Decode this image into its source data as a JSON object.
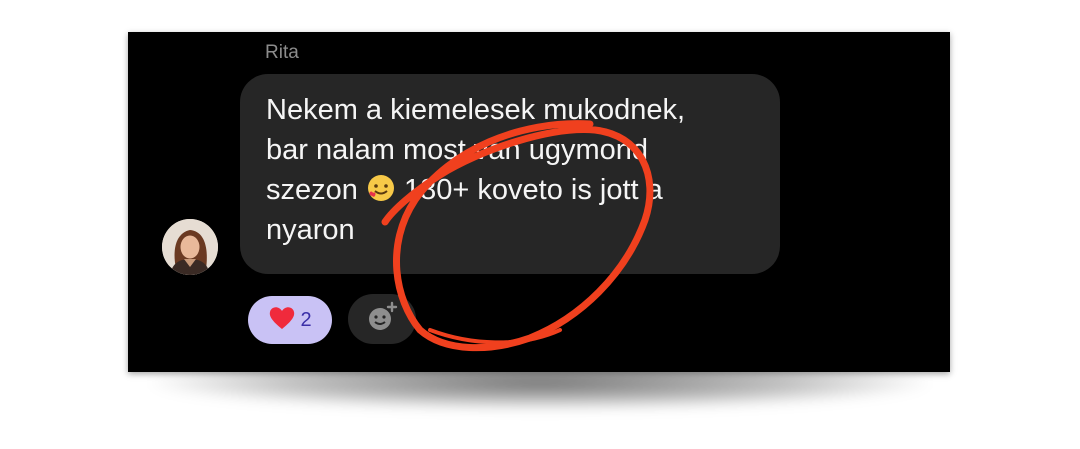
{
  "message": {
    "sender": "Rita",
    "lines": [
      "Nekem a kiemelesek mukodnek,",
      "bar nalam most van ugymond",
      "szezon",
      "180+ koveto is jott a",
      "nyaron"
    ],
    "inline_emoji": "smiling-face-with-hearts-emoji"
  },
  "reactions": {
    "emoji": "❤️",
    "count": "2"
  },
  "colors": {
    "background": "#000000",
    "bubble": "#262626",
    "reaction_pill": "#c9c2f5",
    "annotation": "#f0401e"
  }
}
